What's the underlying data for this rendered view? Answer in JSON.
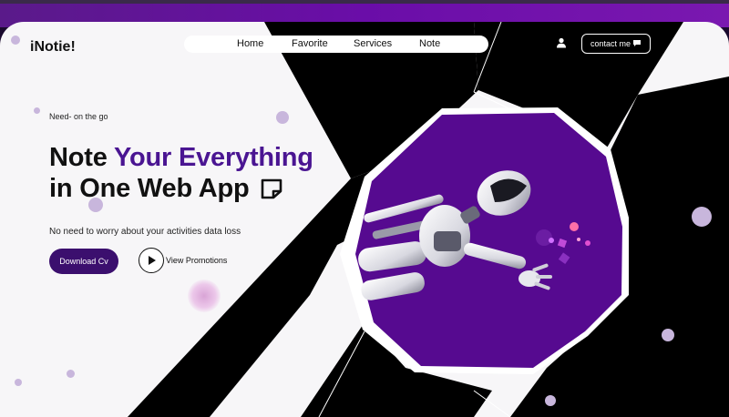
{
  "brand": "iNotie!",
  "nav": {
    "items": [
      {
        "label": "Home"
      },
      {
        "label": "Favorite"
      },
      {
        "label": "Services"
      },
      {
        "label": "Note"
      }
    ]
  },
  "contact": {
    "label": "contact me",
    "icon": "chat-icon"
  },
  "hero": {
    "tagline": "Need- on the go",
    "headline_line1_plain": "Note ",
    "headline_line1_accent": "Your Everything",
    "headline_line2": "in One Web App",
    "headline_icon": "sticky-note-icon",
    "subtext": "No need to worry about your activities data loss",
    "primary_button": "Download Cv",
    "secondary_button": "View Promotions"
  },
  "colors": {
    "accent": "#4a1592",
    "button": "#3b0f6e",
    "hero_purple": "#5a0a96",
    "header_gradient": "#6a0da8"
  },
  "icons": {
    "user": "user-icon",
    "play": "play-icon",
    "image": "robot-illustration"
  }
}
